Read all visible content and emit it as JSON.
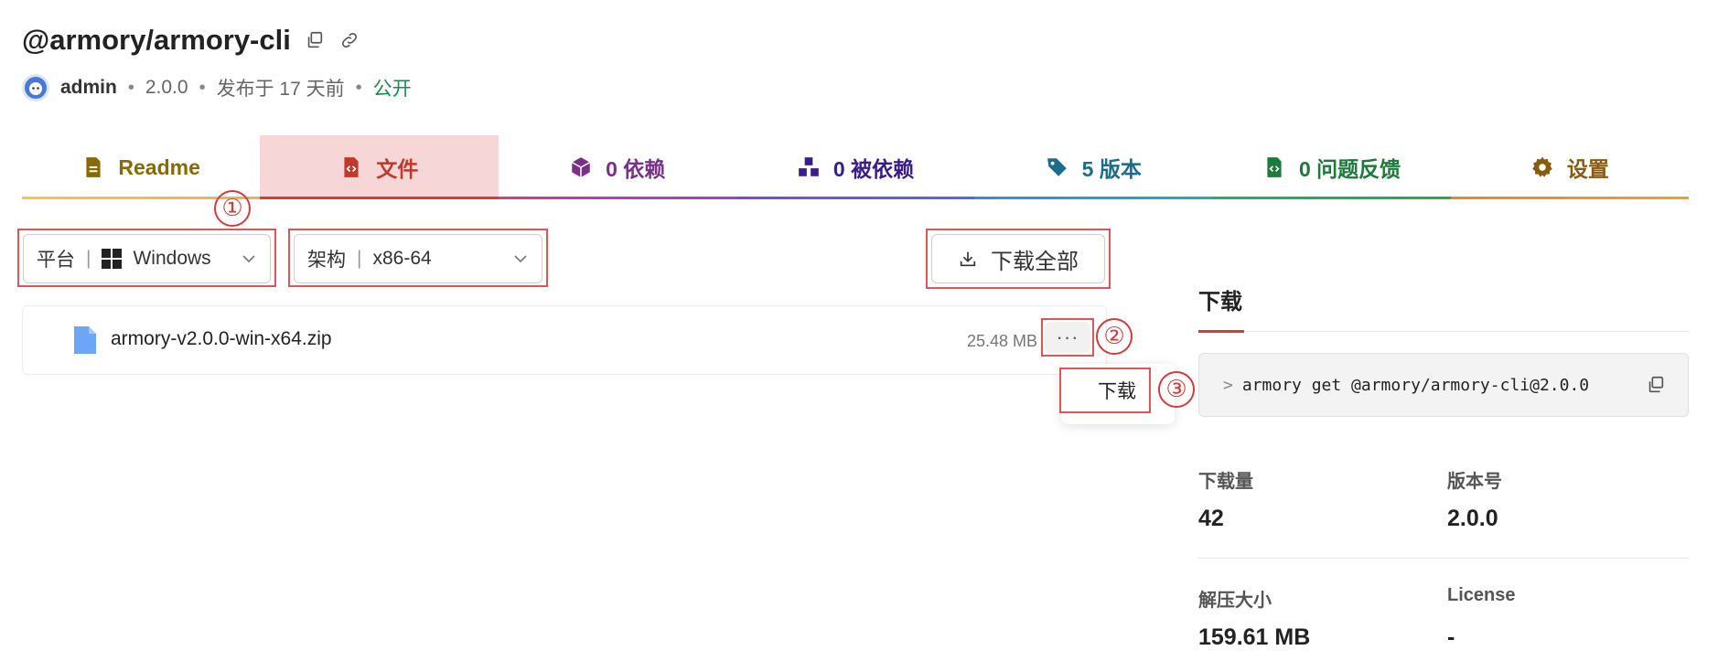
{
  "header": {
    "title": "@armory/armory-cli",
    "user": "admin",
    "version": "2.0.0",
    "published": "发布于 17 天前",
    "visibility": "公开"
  },
  "tabs": [
    {
      "label": "Readme",
      "icon": "file-text-icon"
    },
    {
      "label": "文件",
      "icon": "file-code-icon",
      "active": true
    },
    {
      "label": "0 依赖",
      "icon": "box-icon"
    },
    {
      "label": "0 被依赖",
      "icon": "boxes-icon"
    },
    {
      "label": "5 版本",
      "icon": "tags-icon"
    },
    {
      "label": "0 问题反馈",
      "icon": "file-issue-icon"
    },
    {
      "label": "设置",
      "icon": "gear-icon"
    }
  ],
  "filters": {
    "platform_label": "平台",
    "platform_value": "Windows",
    "arch_label": "架构",
    "arch_value": "x86-64",
    "download_all": "下载全部"
  },
  "files": [
    {
      "name": "armory-v2.0.0-win-x64.zip",
      "size": "25.48 MB"
    }
  ],
  "menu": {
    "more": "···",
    "download": "下载"
  },
  "annotations": [
    "①",
    "②",
    "③"
  ],
  "side": {
    "title": "下载",
    "command_prompt": ">",
    "command": "armory get @armory/armory-cli@2.0.0",
    "downloads_label": "下载量",
    "downloads_value": "42",
    "version_label": "版本号",
    "version_value": "2.0.0",
    "size_label": "解压大小",
    "size_value": "159.61 MB",
    "license_label": "License",
    "license_value": "-"
  },
  "colors": {
    "accent": "#d43c3c",
    "public": "#1f8a4c"
  }
}
